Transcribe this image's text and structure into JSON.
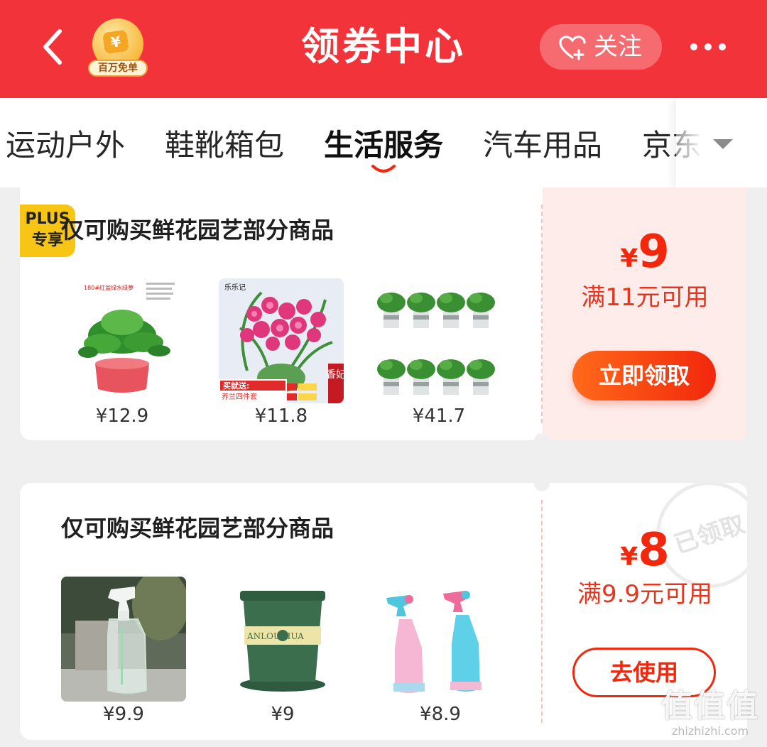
{
  "header": {
    "title": "领券中心",
    "badge_label": "百万免单",
    "badge_coin": "¥",
    "follow_label": "关注",
    "colors": {
      "bar": "#f2333a"
    }
  },
  "tabs": [
    {
      "label": "运动户外"
    },
    {
      "label": "鞋靴箱包"
    },
    {
      "label": "生活服务",
      "active": true
    },
    {
      "label": "汽车用品"
    },
    {
      "label": "京东"
    }
  ],
  "coupons": [
    {
      "tag": {
        "line1": "PLUS",
        "line2": "专享"
      },
      "title": "仅可购买鲜花园艺部分商品",
      "currency": "¥",
      "amount": "9",
      "condition": "满11元可用",
      "button_label": "立即领取",
      "products": [
        {
          "name": "绿萝盆栽",
          "price": "¥12.9",
          "img_text": "180#红盆绿水绿萝"
        },
        {
          "name": "兰花四件套",
          "price": "¥11.8",
          "img_text_top": "乐乐记",
          "img_text_promo": "买就送:",
          "img_text_promo2": "养兰四件套",
          "img_side": "香妃"
        },
        {
          "name": "绿萝八盆装",
          "price": "¥41.7"
        }
      ]
    },
    {
      "title": "仅可购买鲜花园艺部分商品",
      "currency": "¥",
      "amount": "8",
      "condition": "满9.9元可用",
      "button_label": "去使用",
      "stamp": "已领取",
      "products": [
        {
          "name": "透明喷壶",
          "price": "¥9.9"
        },
        {
          "name": "绿色花盆",
          "price": "¥9",
          "img_text": "ANLOU HUA"
        },
        {
          "name": "彩色喷壶",
          "price": "¥8.9"
        }
      ]
    }
  ],
  "watermark": {
    "logo": "值值值",
    "url": "zhizhizhi.com"
  }
}
